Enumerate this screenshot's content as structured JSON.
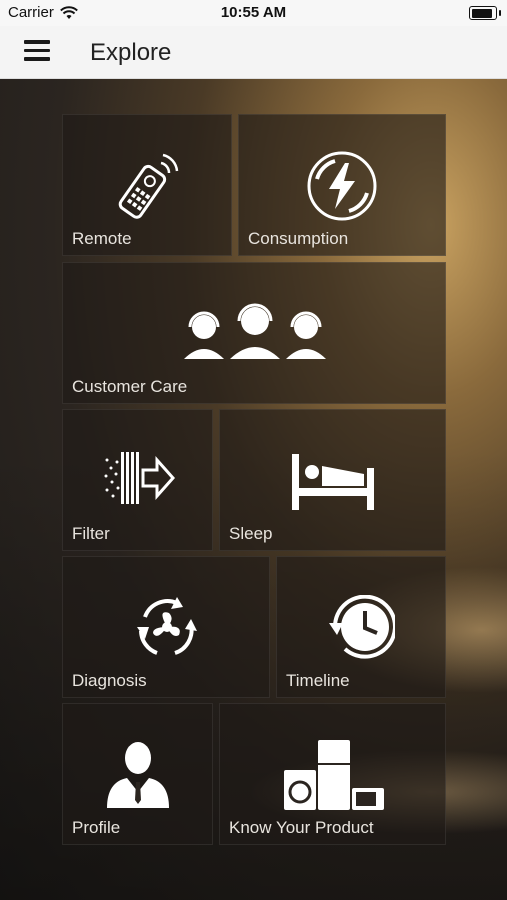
{
  "status_bar": {
    "carrier": "Carrier",
    "time": "10:55 AM",
    "battery_level": 0.8
  },
  "nav": {
    "title": "Explore",
    "menu_icon": "hamburger-menu-icon"
  },
  "tiles": [
    {
      "label": "Remote",
      "icon": "remote-control-icon"
    },
    {
      "label": "Consumption",
      "icon": "energy-bolt-icon"
    },
    {
      "label": "Customer Care",
      "icon": "support-agents-icon"
    },
    {
      "label": "Filter",
      "icon": "air-filter-icon"
    },
    {
      "label": "Sleep",
      "icon": "bed-icon"
    },
    {
      "label": "Diagnosis",
      "icon": "fan-cycle-icon"
    },
    {
      "label": "Timeline",
      "icon": "history-clock-icon"
    },
    {
      "label": "Profile",
      "icon": "user-profile-icon"
    },
    {
      "label": "Know Your Product",
      "icon": "appliances-icon"
    }
  ],
  "colors": {
    "tile_background": "#1e1a16",
    "icon": "#ffffff",
    "accent_glow": "#c9a261"
  }
}
